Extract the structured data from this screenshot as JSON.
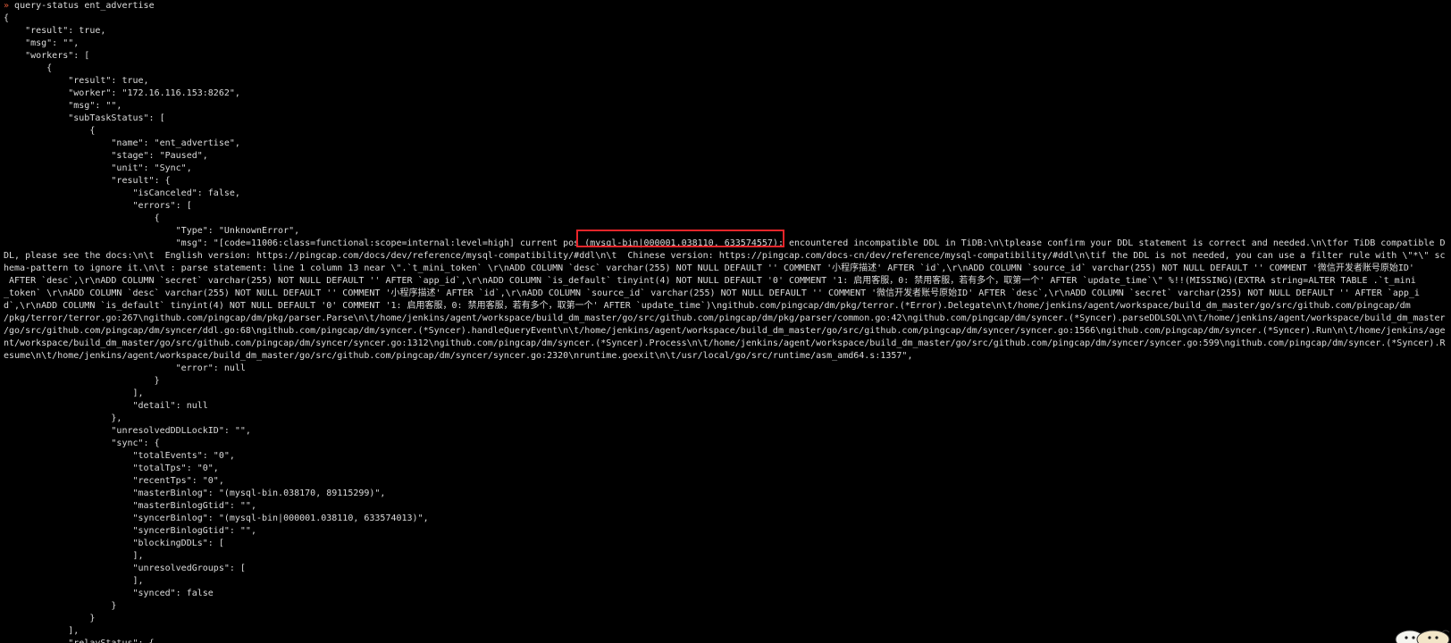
{
  "terminal": {
    "prompt_symbol": "»",
    "command": " query-status ent_advertise",
    "lines": [
      "{",
      "    \"result\": true,",
      "    \"msg\": \"\",",
      "    \"workers\": [",
      "        {",
      "            \"result\": true,",
      "            \"worker\": \"172.16.116.153:8262\",",
      "            \"msg\": \"\",",
      "            \"subTaskStatus\": [",
      "                {",
      "                    \"name\": \"ent_advertise\",",
      "                    \"stage\": \"Paused\",",
      "                    \"unit\": \"Sync\",",
      "                    \"result\": {",
      "                        \"isCanceled\": false,",
      "                        \"errors\": [",
      "                            {",
      "                                \"Type\": \"UnknownError\",",
      "                                \"msg\": \"[code=11006:class=functional:scope=internal:level=high] current pos (mysql-bin|000001.038110, 633574557): encountered incompatible DDL in TiDB:\\n\\tplease confirm your DDL statement is correct and needed.\\n\\tfor TiDB compatible D",
      "DL, please see the docs:\\n\\t  English version: https://pingcap.com/docs/dev/reference/mysql-compatibility/#ddl\\n\\t  Chinese version: https://pingcap.com/docs-cn/dev/reference/mysql-compatibility/#ddl\\n\\tif the DDL is not needed, you can use a filter rule with \\\"*\\\" sc",
      "hema-pattern to ignore it.\\n\\t : parse statement: line 1 column 13 near \\\".`t_mini_token` \\r\\nADD COLUMN `desc` varchar(255) NOT NULL DEFAULT '' COMMENT '小程序描述' AFTER `id`,\\r\\nADD COLUMN `source_id` varchar(255) NOT NULL DEFAULT '' COMMENT '微信开发者账号原始ID'",
      " AFTER `desc`,\\r\\nADD COLUMN `secret` varchar(255) NOT NULL DEFAULT '' AFTER `app_id`,\\r\\nADD COLUMN `is_default` tinyint(4) NOT NULL DEFAULT '0' COMMENT '1: 启用客服，0: 禁用客服，若有多个，取第一个' AFTER `update_time`\\\" %!!(MISSING)(EXTRA string=ALTER TABLE .`t_mini",
      "_token` \\r\\nADD COLUMN `desc` varchar(255) NOT NULL DEFAULT '' COMMENT '小程序描述' AFTER `id`,\\r\\nADD COLUMN `source_id` varchar(255) NOT NULL DEFAULT '' COMMENT '微信开发者账号原始ID' AFTER `desc`,\\r\\nADD COLUMN `secret` varchar(255) NOT NULL DEFAULT '' AFTER `app_i",
      "d`,\\r\\nADD COLUMN `is_default` tinyint(4) NOT NULL DEFAULT '0' COMMENT '1: 启用客服，0: 禁用客服，若有多个，取第一个' AFTER `update_time`)\\ngithub.com/pingcap/dm/pkg/terror.(*Error).Delegate\\n\\t/home/jenkins/agent/workspace/build_dm_master/go/src/github.com/pingcap/dm",
      "/pkg/terror/terror.go:267\\ngithub.com/pingcap/dm/pkg/parser.Parse\\n\\t/home/jenkins/agent/workspace/build_dm_master/go/src/github.com/pingcap/dm/pkg/parser/common.go:42\\ngithub.com/pingcap/dm/syncer.(*Syncer).parseDDLSQL\\n\\t/home/jenkins/agent/workspace/build_dm_master",
      "/go/src/github.com/pingcap/dm/syncer/ddl.go:68\\ngithub.com/pingcap/dm/syncer.(*Syncer).handleQueryEvent\\n\\t/home/jenkins/agent/workspace/build_dm_master/go/src/github.com/pingcap/dm/syncer/syncer.go:1566\\ngithub.com/pingcap/dm/syncer.(*Syncer).Run\\n\\t/home/jenkins/age",
      "nt/workspace/build_dm_master/go/src/github.com/pingcap/dm/syncer/syncer.go:1312\\ngithub.com/pingcap/dm/syncer.(*Syncer).Process\\n\\t/home/jenkins/agent/workspace/build_dm_master/go/src/github.com/pingcap/dm/syncer/syncer.go:599\\ngithub.com/pingcap/dm/syncer.(*Syncer).R",
      "esume\\n\\t/home/jenkins/agent/workspace/build_dm_master/go/src/github.com/pingcap/dm/syncer/syncer.go:2320\\nruntime.goexit\\n\\t/usr/local/go/src/runtime/asm_amd64.s:1357\",",
      "                                \"error\": null",
      "                            }",
      "                        ],",
      "                        \"detail\": null",
      "                    },",
      "                    \"unresolvedDDLLockID\": \"\",",
      "                    \"sync\": {",
      "                        \"totalEvents\": \"0\",",
      "                        \"totalTps\": \"0\",",
      "                        \"recentTps\": \"0\",",
      "                        \"masterBinlog\": \"(mysql-bin.038170, 89115299)\",",
      "                        \"masterBinlogGtid\": \"\",",
      "                        \"syncerBinlog\": \"(mysql-bin|000001.038110, 633574013)\",",
      "                        \"syncerBinlogGtid\": \"\",",
      "                        \"blockingDDLs\": [",
      "                        ],",
      "                        \"unresolvedGroups\": [",
      "                        ],",
      "                        \"synced\": false",
      "                    }",
      "                }",
      "            ],",
      "            \"relayStatus\": {"
    ]
  },
  "colors": {
    "background": "#000000",
    "text": "#dcdcdc",
    "highlight_border": "#e8252a",
    "prompt": "#e05a3a"
  },
  "icons": {
    "corner_avatar": "cartoon-avatar-icon"
  }
}
